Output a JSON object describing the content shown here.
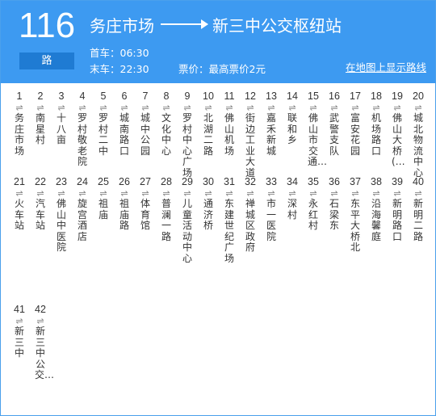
{
  "route": {
    "number": "116",
    "badge": "路",
    "origin": "务庄市场",
    "destination": "新三中公交枢纽站",
    "first_bus": "首车：06:30",
    "last_bus": "末车：22:30",
    "fare": "票价：最高票价2元",
    "map_link": "在地图上显示路线"
  },
  "swap_symbol": "⇌",
  "stops": [
    {
      "num": "1",
      "name": "务庄市场"
    },
    {
      "num": "2",
      "name": "南星村"
    },
    {
      "num": "3",
      "name": "十八亩"
    },
    {
      "num": "4",
      "name": "罗村敬老院"
    },
    {
      "num": "5",
      "name": "罗村二中"
    },
    {
      "num": "6",
      "name": "城南路口"
    },
    {
      "num": "7",
      "name": "城中公园"
    },
    {
      "num": "8",
      "name": "文化中心"
    },
    {
      "num": "9",
      "name": "罗村中心广场"
    },
    {
      "num": "10",
      "name": "北湖二路"
    },
    {
      "num": "11",
      "name": "佛山机场"
    },
    {
      "num": "12",
      "name": "街边工业大道"
    },
    {
      "num": "13",
      "name": "嘉禾新城"
    },
    {
      "num": "14",
      "name": "联和乡"
    },
    {
      "num": "15",
      "name": "佛山市交通…"
    },
    {
      "num": "16",
      "name": "武警支队"
    },
    {
      "num": "17",
      "name": "富安花园"
    },
    {
      "num": "18",
      "name": "机场路口"
    },
    {
      "num": "19",
      "name": "佛山大桥(…"
    },
    {
      "num": "20",
      "name": "城北物流中心"
    },
    {
      "num": "21",
      "name": "火车站"
    },
    {
      "num": "22",
      "name": "汽车站"
    },
    {
      "num": "23",
      "name": "佛山中医院"
    },
    {
      "num": "24",
      "name": "旋宫酒店"
    },
    {
      "num": "25",
      "name": "祖庙"
    },
    {
      "num": "26",
      "name": "祖庙路"
    },
    {
      "num": "27",
      "name": "体育馆"
    },
    {
      "num": "28",
      "name": "普澜一路"
    },
    {
      "num": "29",
      "name": "儿童活动中心"
    },
    {
      "num": "30",
      "name": "通济桥"
    },
    {
      "num": "31",
      "name": "东建世纪广场"
    },
    {
      "num": "32",
      "name": "禅城区政府"
    },
    {
      "num": "33",
      "name": "市一医院"
    },
    {
      "num": "34",
      "name": "深村"
    },
    {
      "num": "35",
      "name": "永红村"
    },
    {
      "num": "36",
      "name": "石梁东"
    },
    {
      "num": "37",
      "name": "东平大桥北"
    },
    {
      "num": "38",
      "name": "沿海馨庭"
    },
    {
      "num": "39",
      "name": "新明路口"
    },
    {
      "num": "40",
      "name": "新明二路"
    },
    {
      "num": "41",
      "name": "新三中"
    },
    {
      "num": "42",
      "name": "新三中公交…"
    }
  ]
}
